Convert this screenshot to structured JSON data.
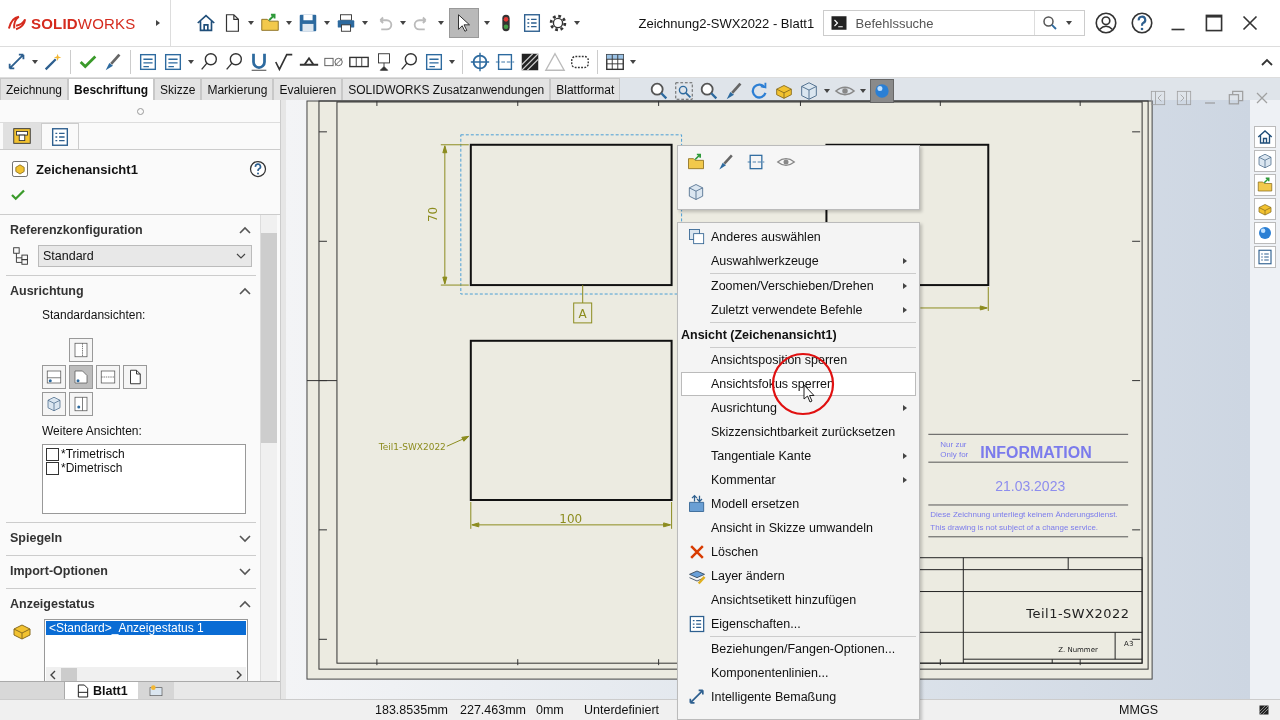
{
  "window": {
    "title": "Zeichnung2-SWX2022 - Blatt1"
  },
  "logo": {
    "brand": "**SOLID**WORKS"
  },
  "search": {
    "placeholder": "Befehlssuche"
  },
  "tabs": [
    {
      "label": "Zeichnung",
      "selected": false
    },
    {
      "label": "Beschriftung",
      "selected": true
    },
    {
      "label": "Skizze",
      "selected": false
    },
    {
      "label": "Markierung",
      "selected": false
    },
    {
      "label": "Evaluieren",
      "selected": false
    },
    {
      "label": "SOLIDWORKS Zusatzanwendungen",
      "selected": false
    },
    {
      "label": "Blattformat",
      "selected": false
    }
  ],
  "property_manager": {
    "panel_tabs": [
      {
        "selected": false
      },
      {
        "selected": true
      }
    ],
    "title": "Zeichenansicht1",
    "sections": [
      {
        "kind": "configuration",
        "title": "Referenzkonfiguration",
        "expanded": true,
        "value": "Standard"
      },
      {
        "kind": "orientation",
        "title": "Ausrichtung",
        "expanded": true,
        "standard_label": "Standardansichten:",
        "views": [
          {
            "selected": false
          },
          {
            "selected": false
          },
          {
            "selected": true
          },
          {
            "selected": false
          },
          {
            "selected": false
          },
          {
            "selected": false
          },
          {
            "selected": false
          }
        ],
        "more_label": "Weitere Ansichten:",
        "more_views": [
          {
            "label": "*Trimetrisch",
            "checked": false
          },
          {
            "label": "*Dimetrisch",
            "checked": false
          }
        ]
      },
      {
        "kind": "plain",
        "title": "Spiegeln",
        "expanded": false
      },
      {
        "kind": "plain",
        "title": "Import-Optionen",
        "expanded": false
      },
      {
        "kind": "display",
        "title": "Anzeigestatus",
        "expanded": true,
        "items": [
          {
            "label": "<Standard>_Anzeigestatus 1",
            "selected": true
          }
        ]
      }
    ]
  },
  "sheet_tabs": [
    {
      "label": "Blatt1",
      "selected": true
    }
  ],
  "drawing": {
    "height_dimension": "70",
    "width_dimension": "100",
    "view_label": "A",
    "model_label": "Teil1-SWX2022",
    "stamp": {
      "note_de": "Nur zur",
      "note_en": "Only for",
      "title": "INFORMATION",
      "date": "21.03.2023",
      "disclaimer_de": "Diese Zeichnung unterliegt keinem Änderungsdienst.",
      "disclaimer_en": "This drawing is not subject of a change service."
    },
    "title_block": {
      "part": "Teil1-SWX2022",
      "number": "Z. Nummer",
      "size": "A3"
    }
  },
  "context_menu": {
    "items": [
      {
        "kind": "item",
        "label": "Anderes auswählen",
        "submenu": false,
        "selected": false
      },
      {
        "kind": "item",
        "label": "Auswahlwerkzeuge",
        "submenu": true,
        "selected": false
      },
      {
        "kind": "separator"
      },
      {
        "kind": "item",
        "label": "Zoomen/Verschieben/Drehen",
        "submenu": true,
        "selected": false
      },
      {
        "kind": "item",
        "label": "Zuletzt verwendete Befehle",
        "submenu": true,
        "selected": false
      },
      {
        "kind": "separator"
      },
      {
        "kind": "header",
        "label": "Ansicht (Zeichenansicht1)"
      },
      {
        "kind": "separator"
      },
      {
        "kind": "item",
        "label": "Ansichtsposition sperren",
        "submenu": false,
        "selected": false
      },
      {
        "kind": "item",
        "label": "Ansichtsfokus sperren",
        "submenu": false,
        "selected": true
      },
      {
        "kind": "item",
        "label": "Ausrichtung",
        "submenu": true,
        "selected": false
      },
      {
        "kind": "item",
        "label": "Skizzensichtbarkeit zurücksetzen",
        "submenu": false,
        "selected": false
      },
      {
        "kind": "item",
        "label": "Tangentiale Kante",
        "submenu": true,
        "selected": false
      },
      {
        "kind": "item",
        "label": "Kommentar",
        "submenu": true,
        "selected": false
      },
      {
        "kind": "item",
        "label": "Modell ersetzen",
        "submenu": false,
        "selected": false
      },
      {
        "kind": "item",
        "label": "Ansicht in Skizze umwandeln",
        "submenu": false,
        "selected": false
      },
      {
        "kind": "item",
        "label": "Löschen",
        "submenu": false,
        "selected": false
      },
      {
        "kind": "item",
        "label": "Layer ändern",
        "submenu": false,
        "selected": false
      },
      {
        "kind": "item",
        "label": "Ansichtsetikett hinzufügen",
        "submenu": false,
        "selected": false
      },
      {
        "kind": "item",
        "label": "Eigenschaften...",
        "submenu": false,
        "selected": false
      },
      {
        "kind": "separator"
      },
      {
        "kind": "item",
        "label": "Beziehungen/Fangen-Optionen...",
        "submenu": false,
        "selected": false
      },
      {
        "kind": "item",
        "label": "Komponentenlinien...",
        "submenu": false,
        "selected": false
      },
      {
        "kind": "item",
        "label": "Intelligente Bemaßung",
        "submenu": false,
        "selected": false
      }
    ]
  },
  "status_bar": {
    "fields": [
      "183.8535mm",
      "227.463mm",
      "0mm",
      "Unterdefiniert",
      "MMGS"
    ]
  }
}
